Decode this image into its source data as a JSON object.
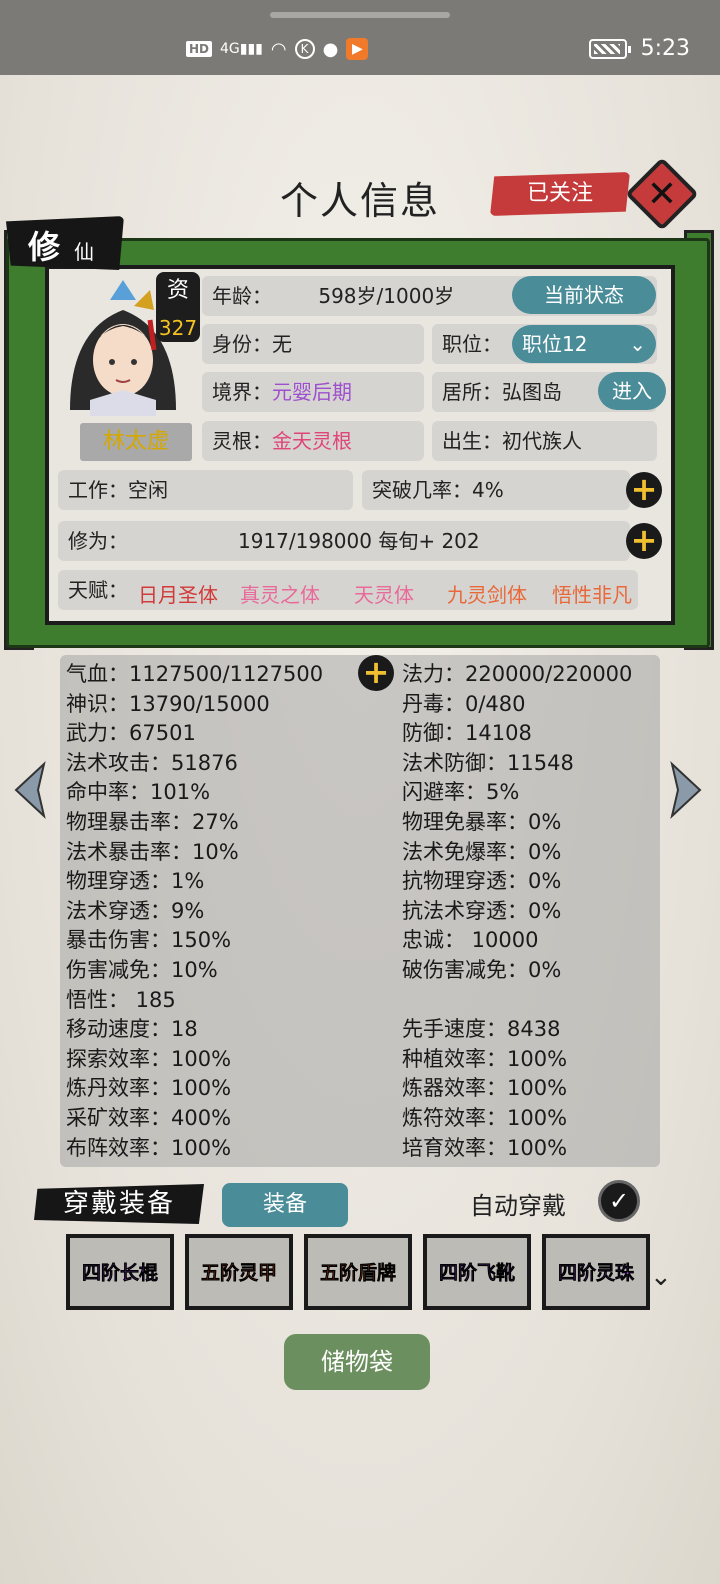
{
  "statusbar": {
    "icons": [
      "HD",
      "4G",
      "signal",
      "wifi",
      "k-icon",
      "ball-icon",
      "play-icon"
    ],
    "time": "5:23"
  },
  "header": {
    "title": "个人信息",
    "follow_label": "已关注",
    "close_label": "✕"
  },
  "rank": {
    "main": "修",
    "sub": "仙"
  },
  "profile": {
    "zi_label": "资",
    "zi_value": "327",
    "name": "林太虚",
    "age_label": "年龄：",
    "age_value": "598岁/1000岁",
    "status_button": "当前状态",
    "identity": "身份：无",
    "position_label": "职位：",
    "position_value": "职位12",
    "realm_label": "境界：",
    "realm_value": "元婴后期",
    "residence": "居所：弘图岛",
    "enter_button": "进入",
    "root_label": "灵根：",
    "root_value": "金天灵根",
    "birth": "出生：初代族人",
    "work": "工作：空闲",
    "breakthrough": "突破几率：4%",
    "cultivation_label": "修为：",
    "cultivation_value": "1917/198000  每旬+ 202",
    "talent_label": "天赋：",
    "talents": [
      {
        "text": "日月圣体",
        "color": "#d23a3a"
      },
      {
        "text": "真灵之体",
        "color": "#e86a9a"
      },
      {
        "text": "天灵体",
        "color": "#e86a9a"
      },
      {
        "text": "九灵剑体",
        "color": "#e8683a"
      },
      {
        "text": "悟性非凡",
        "color": "#e8683a"
      }
    ]
  },
  "stats": {
    "left": [
      "气血：1127500/1127500",
      "神识：13790/15000",
      "武力：67501",
      "法术攻击：51876",
      "命中率：101%",
      "物理暴击率：27%",
      "法术暴击率：10%",
      "物理穿透：1%",
      "法术穿透：9%",
      "暴击伤害：150%",
      "伤害减免：10%",
      "悟性： 185",
      "移动速度：18",
      "探索效率：100%",
      "炼丹效率：100%",
      "采矿效率：400%",
      "布阵效率：100%"
    ],
    "right": [
      "法力：220000/220000",
      "丹毒：0/480",
      "防御：14108",
      "法术防御：11548",
      "闪避率：5%",
      "物理免暴率：0%",
      "法术免爆率：0%",
      "抗物理穿透：0%",
      "抗法术穿透：0%",
      "忠诚： 10000",
      "破伤害减免：0%",
      "",
      "先手速度：8438",
      "种植效率：100%",
      "炼器效率：100%",
      "炼符效率：100%",
      "培育效率：100%"
    ]
  },
  "equipment": {
    "label": "穿戴装备",
    "button": "装备",
    "auto_label": "自动穿戴",
    "slots": [
      {
        "name": "四阶长棍",
        "color": "#8a3fd0"
      },
      {
        "name": "五阶灵甲",
        "color": "#e8602a"
      },
      {
        "name": "五阶盾牌",
        "color": "#e8602a"
      },
      {
        "name": "四阶飞靴",
        "color": "#8a3fd0"
      },
      {
        "name": "四阶灵珠",
        "color": "#8a3fd0"
      }
    ]
  },
  "bag_button": "储物袋"
}
